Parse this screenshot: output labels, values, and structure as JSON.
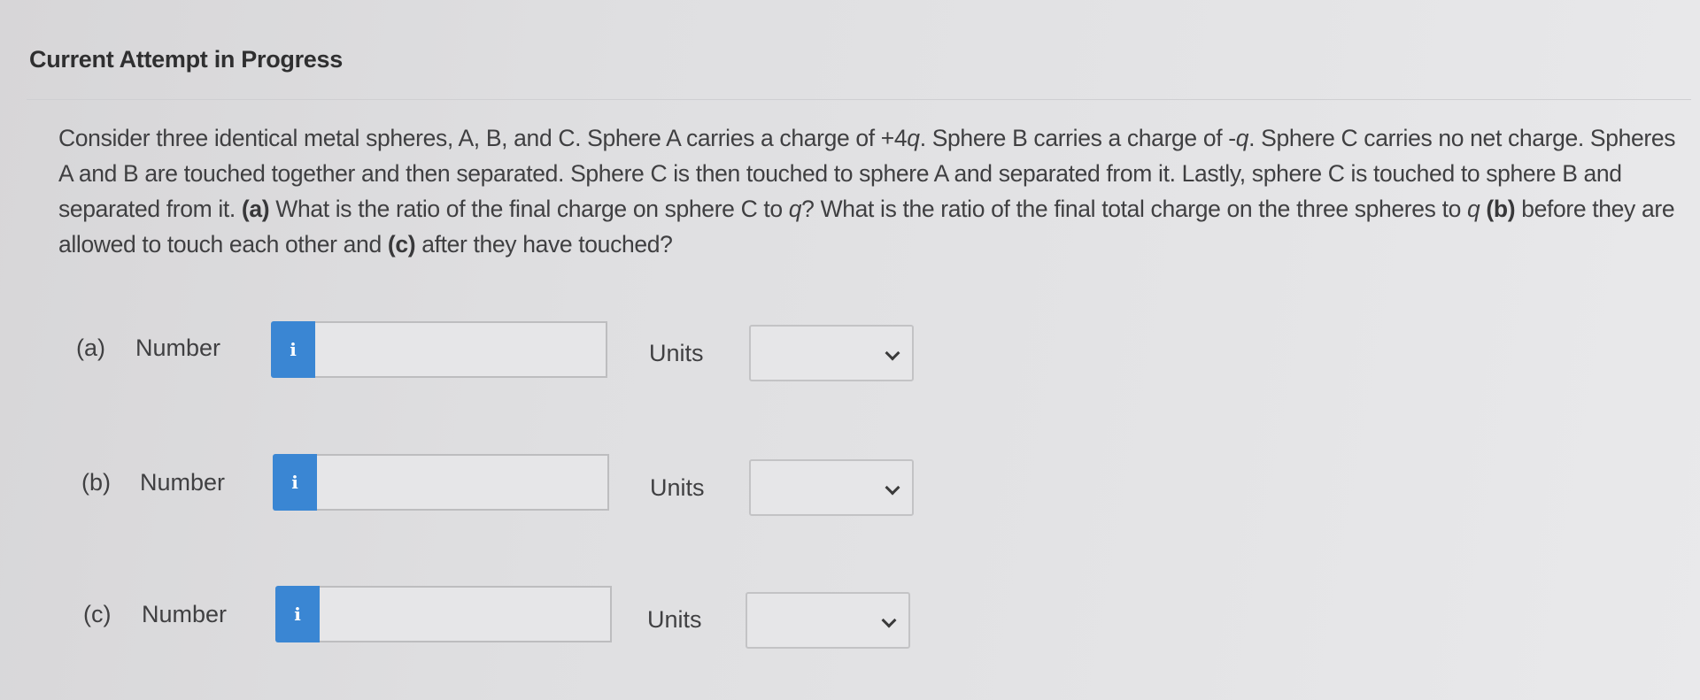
{
  "header": {
    "title": "Current Attempt in Progress"
  },
  "question": {
    "segments": [
      {
        "text": "Consider three identical metal spheres, A, B, and C. Sphere A carries a charge of +4",
        "style": "normal"
      },
      {
        "text": "q",
        "style": "italic"
      },
      {
        "text": ". Sphere B carries a charge of -",
        "style": "normal"
      },
      {
        "text": "q",
        "style": "italic"
      },
      {
        "text": ". Sphere C carries no net charge. Spheres A and B are touched together and then separated. Sphere C is then touched to sphere A and separated from it. Lastly, sphere C is touched to sphere B and separated from it. ",
        "style": "normal"
      },
      {
        "text": "(a)",
        "style": "bold"
      },
      {
        "text": " What is the ratio of the final charge on sphere C to ",
        "style": "normal"
      },
      {
        "text": "q",
        "style": "italic"
      },
      {
        "text": "? What is the ratio of the final total charge on the three spheres to ",
        "style": "normal"
      },
      {
        "text": "q",
        "style": "italic"
      },
      {
        "text": " ",
        "style": "normal"
      },
      {
        "text": "(b)",
        "style": "bold"
      },
      {
        "text": " before they are allowed to touch each other and ",
        "style": "normal"
      },
      {
        "text": "(c)",
        "style": "bold"
      },
      {
        "text": " after they have touched?",
        "style": "normal"
      }
    ]
  },
  "answers": [
    {
      "part": "(a)",
      "number_label": "Number",
      "info_icon": "i",
      "number_value": "",
      "units_label": "Units",
      "units_selected": ""
    },
    {
      "part": "(b)",
      "number_label": "Number",
      "info_icon": "i",
      "number_value": "",
      "units_label": "Units",
      "units_selected": ""
    },
    {
      "part": "(c)",
      "number_label": "Number",
      "info_icon": "i",
      "number_value": "",
      "units_label": "Units",
      "units_selected": ""
    }
  ],
  "colors": {
    "info_button": "#3a86d3",
    "background": "#e2e2e4",
    "text": "#3f3f41"
  }
}
